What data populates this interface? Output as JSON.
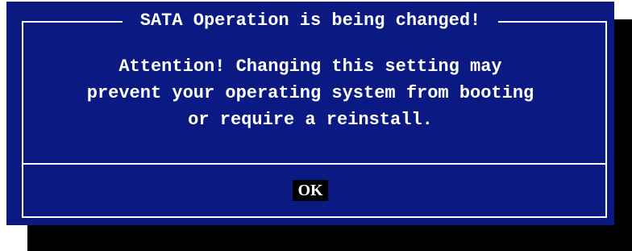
{
  "dialog": {
    "title": "SATA Operation is being changed!",
    "message_lines": [
      "Attention! Changing this setting may",
      "prevent your operating system from booting",
      "or require a reinstall."
    ],
    "ok_label": "OK"
  },
  "colors": {
    "dialog_background": "#0a1a82",
    "text": "#ffffff",
    "button_background": "#000000",
    "shadow": "#000000"
  }
}
